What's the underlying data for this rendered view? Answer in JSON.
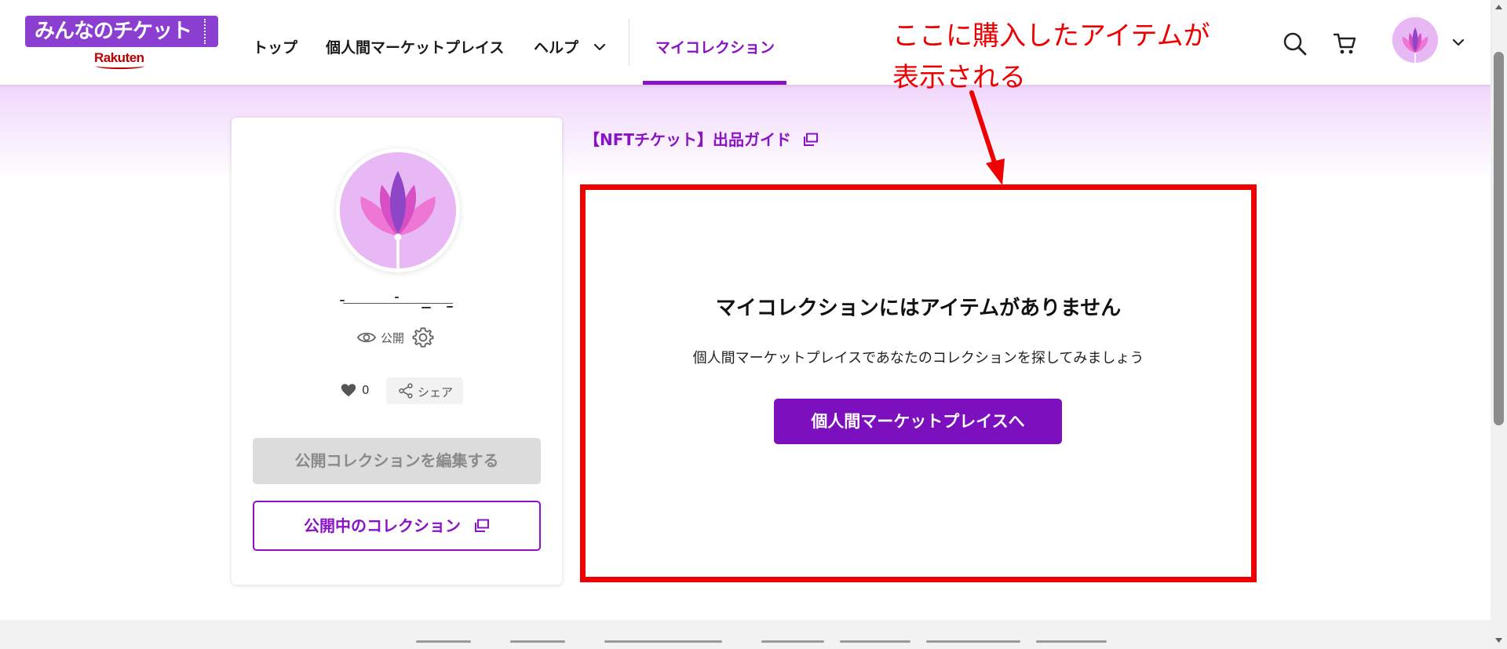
{
  "header": {
    "logo_text": "みんなのチケット",
    "logo_brand": "Rakuten",
    "nav": [
      {
        "label": "トップ"
      },
      {
        "label": "個人間マーケットプレイス"
      },
      {
        "label": "ヘルプ"
      },
      {
        "label": "マイコレクション",
        "active": true
      }
    ],
    "icons": [
      "search-icon",
      "cart-icon",
      "chevron-down-icon"
    ]
  },
  "annotation": {
    "text_line1": "ここに購入したアイテムが",
    "text_line2": "表示される",
    "color": "#ee0000"
  },
  "profile": {
    "visibility_label": "公開",
    "likes": "0",
    "share_label": "シェア",
    "edit_button": "公開コレクションを編集する",
    "public_collection_button": "公開中のコレクション"
  },
  "main": {
    "guide_link": "【NFTチケット】出品ガイド",
    "empty_title": "マイコレクションにはアイテムがありません",
    "empty_subtitle": "個人間マーケットプレイスであなたのコレクションを探してみましょう",
    "cta_button": "個人間マーケットプレイスへ"
  },
  "colors": {
    "accent": "#8a11c4",
    "button_primary": "#7c0fbe",
    "highlight_border": "#ee0000",
    "band_gradient_top": "#f0d6fb"
  }
}
